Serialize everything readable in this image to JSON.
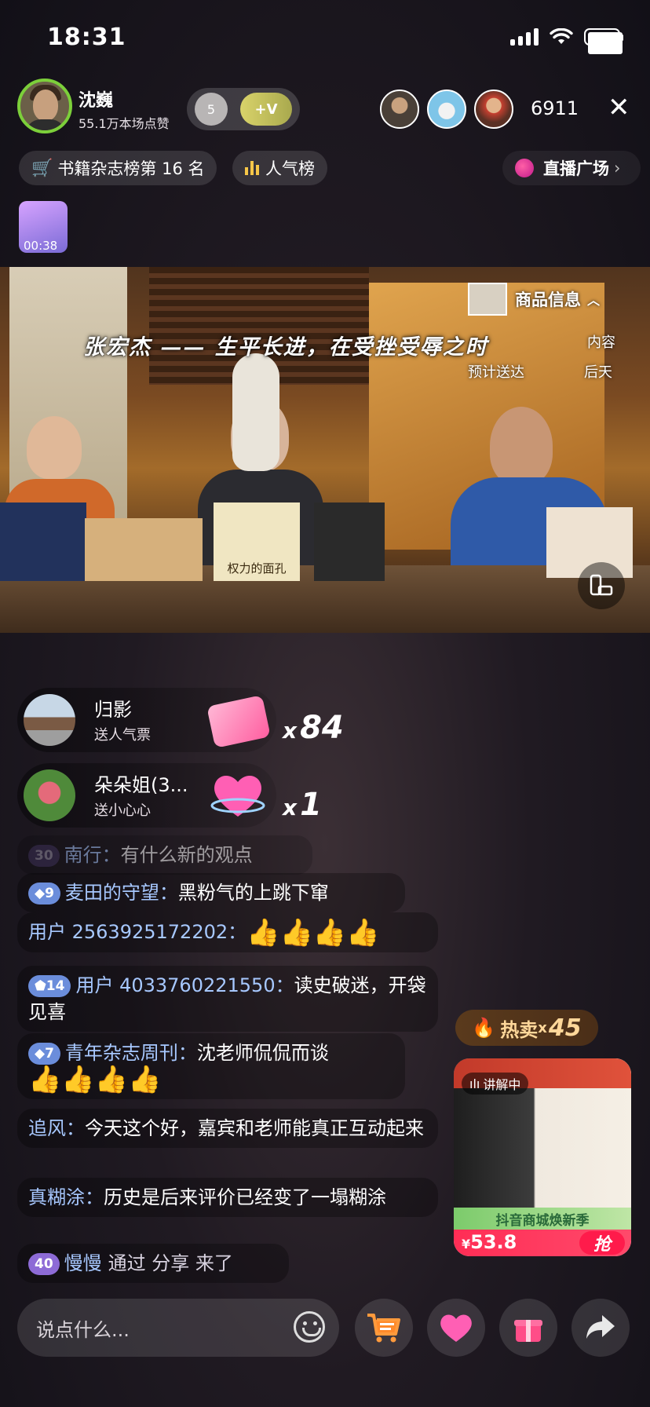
{
  "status_bar": {
    "time": "18:31"
  },
  "host": {
    "name": "沈巍",
    "likes": "55.1万本场点赞"
  },
  "fan_club": {
    "level": "5",
    "join": "+V"
  },
  "viewers": {
    "count": "6911"
  },
  "pills": {
    "rank": "书籍杂志榜第 16 名",
    "popularity": "人气榜",
    "plaza": "直播广场"
  },
  "gift_timer": "00:38",
  "video": {
    "subtitle": "张宏杰 —— 生平长进，在受挫受辱之时",
    "product_info_label": "商品信息",
    "content_label": "内容",
    "delivery_label": "预计送达",
    "delivery_value": "后天",
    "book_title": "权力的面孔"
  },
  "gifts": [
    {
      "user": "归影",
      "action": "送人气票",
      "count": "84"
    },
    {
      "user": "朵朵姐(3...",
      "action": "送小心心",
      "count": "1"
    }
  ],
  "chat": [
    {
      "level": "30",
      "name": "南行：",
      "text": "有什么新的观点"
    },
    {
      "level": "9",
      "name": "麦田的守望：",
      "text": "黑粉气的上跳下窜"
    },
    {
      "level": "",
      "name": "用户 2563925172202：",
      "text": "👍👍👍👍"
    },
    {
      "level": "14",
      "name": "用户 4033760221550：",
      "text": "读史破迷，开袋见喜"
    },
    {
      "level": "7",
      "name": "青年杂志周刊：",
      "text": "沈老师侃侃而谈"
    },
    {
      "level": "",
      "name": "追风：",
      "text": "今天这个好，嘉宾和老师能真正互动起来"
    },
    {
      "level": "",
      "name": "真糊涂：",
      "text": "历史是后来评价已经变了一塌糊涂"
    },
    {
      "level": "40",
      "name": "慢慢",
      "text": "通过 分享 来了"
    }
  ],
  "hot_sale": {
    "label": "热卖",
    "x": "x",
    "count": "45"
  },
  "product_card": {
    "tag": "讲解中",
    "banner": "抖音商城焕新季",
    "price_symbol": "¥",
    "price": "53.8",
    "buy": "抢"
  },
  "input": {
    "placeholder": "说点什么..."
  },
  "colors": {
    "accent": "#f6c648",
    "price": "#ff2d55",
    "name": "#a7c8ff"
  }
}
